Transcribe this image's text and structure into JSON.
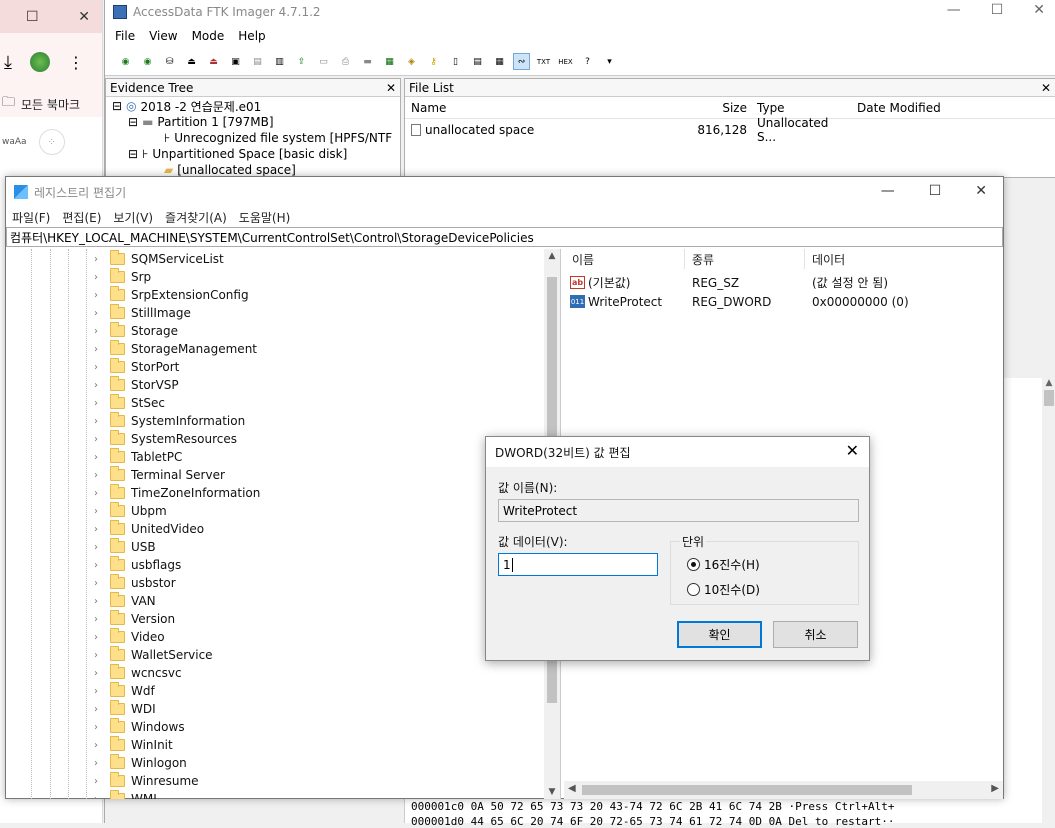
{
  "browser": {
    "bookmarks_label": "모든 북마크",
    "ext_label": "waAa"
  },
  "ftk": {
    "title": "AccessData FTK Imager 4.7.1.2",
    "menu": [
      "File",
      "View",
      "Mode",
      "Help"
    ],
    "evidence_tree": {
      "header": "Evidence Tree",
      "nodes": [
        "2018 -2 연습문제.e01",
        "Partition 1 [797MB]",
        "Unrecognized file system [HPFS/NTF",
        "Unpartitioned Space [basic disk]",
        "[unallocated space]"
      ]
    },
    "file_list": {
      "header": "File List",
      "columns": [
        "Name",
        "Size",
        "Type",
        "Date Modified"
      ],
      "rows": [
        {
          "name": "unallocated space",
          "size": "816,128",
          "type": "Unallocated S...",
          "date": ""
        }
      ]
    },
    "hex_rows": [
      "000001c0  0A 50 72 65 73 73 20 43-74 72 6C 2B 41 6C 74 2B  ·Press Ctrl+Alt+",
      "000001d0  44 65 6C 20 74 6F 20 72-65 73 74 61 72 74 0D 0A  Del to restart··"
    ]
  },
  "regedit": {
    "title": "레지스트리 편집기",
    "menu": [
      "파일(F)",
      "편집(E)",
      "보기(V)",
      "즐겨찾기(A)",
      "도움말(H)"
    ],
    "address": "컴퓨터\\HKEY_LOCAL_MACHINE\\SYSTEM\\CurrentControlSet\\Control\\StorageDevicePolicies",
    "keys": [
      "SQMServiceList",
      "Srp",
      "SrpExtensionConfig",
      "StillImage",
      "Storage",
      "StorageManagement",
      "StorPort",
      "StorVSP",
      "StSec",
      "SystemInformation",
      "SystemResources",
      "TabletPC",
      "Terminal Server",
      "TimeZoneInformation",
      "Ubpm",
      "UnitedVideo",
      "USB",
      "usbflags",
      "usbstor",
      "VAN",
      "Version",
      "Video",
      "WalletService",
      "wcncsvc",
      "Wdf",
      "WDI",
      "Windows",
      "WinInit",
      "Winlogon",
      "Winresume",
      "WMI"
    ],
    "columns": [
      "이름",
      "종류",
      "데이터"
    ],
    "values": [
      {
        "icon": "string-value-icon",
        "name": "(기본값)",
        "type": "REG_SZ",
        "data": "(값 설정 안 됨)"
      },
      {
        "icon": "binary-value-icon",
        "name": "WriteProtect",
        "type": "REG_DWORD",
        "data": "0x00000000 (0)"
      }
    ]
  },
  "dialog": {
    "title": "DWORD(32비트) 값 편집",
    "value_name_label": "값 이름(N):",
    "value_name": "WriteProtect",
    "value_data_label": "값 데이터(V):",
    "value_data": "1",
    "base_label": "단위",
    "hex_label": "16진수(H)",
    "dec_label": "10진수(D)",
    "selected_base": "hex",
    "ok_label": "확인",
    "cancel_label": "취소"
  }
}
